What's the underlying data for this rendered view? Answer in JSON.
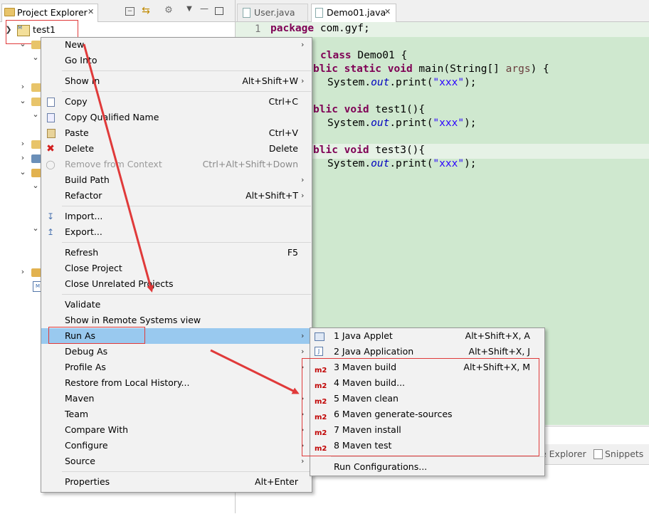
{
  "left_panel": {
    "tab_title": "Project Explorer",
    "tab_close": "✕",
    "tree_root": "test1"
  },
  "editor": {
    "tabs": [
      {
        "label": "User.java",
        "close": ""
      },
      {
        "label": "Demo01.java",
        "close": "✕"
      }
    ],
    "line_number": "1",
    "code": {
      "l1_kw": "package",
      "l1_rest": " com.gyf;",
      "l2_kw": "class",
      "l2_rest": " Demo01 {",
      "l3_kw": "blic static void",
      "l3_rest": " main(String[] ",
      "l3_args": "args",
      "l3_end": ") {",
      "l4_a": "System.",
      "l4_out": "out",
      "l4_b": ".print(",
      "l4_str": "\"xxx\"",
      "l4_c": ");",
      "l5_kw": "blic void",
      "l5_rest": " test1(){",
      "l6_a": "System.",
      "l6_out": "out",
      "l6_b": ".print(",
      "l6_str": "\"xxx\"",
      "l6_c": ");",
      "l7_kw": "blic void",
      "l7_rest": " test3()",
      "l7_end": "{",
      "l8_a": "System.",
      "l8_out": "out",
      "l8_b": ".print(",
      "l8_str": "\"xxx\"",
      "l8_c": ");"
    }
  },
  "bottom_tabs": {
    "explorer": "e Explorer",
    "snippets": "Snippets"
  },
  "context_menu": {
    "items": [
      {
        "label": "New",
        "shortcut": "",
        "submenu": true
      },
      {
        "label": "Go Into",
        "shortcut": ""
      },
      {
        "label": "Show In",
        "shortcut": "Alt+Shift+W",
        "submenu": true
      },
      {
        "label": "Copy",
        "shortcut": "Ctrl+C"
      },
      {
        "label": "Copy Qualified Name",
        "shortcut": ""
      },
      {
        "label": "Paste",
        "shortcut": "Ctrl+V"
      },
      {
        "label": "Delete",
        "shortcut": "Delete"
      },
      {
        "label": "Remove from Context",
        "shortcut": "Ctrl+Alt+Shift+Down",
        "disabled": true
      },
      {
        "label": "Build Path",
        "shortcut": "",
        "submenu": true
      },
      {
        "label": "Refactor",
        "shortcut": "Alt+Shift+T",
        "submenu": true
      },
      {
        "label": "Import...",
        "shortcut": ""
      },
      {
        "label": "Export...",
        "shortcut": ""
      },
      {
        "label": "Refresh",
        "shortcut": "F5"
      },
      {
        "label": "Close Project",
        "shortcut": ""
      },
      {
        "label": "Close Unrelated Projects",
        "shortcut": ""
      },
      {
        "label": "Validate",
        "shortcut": ""
      },
      {
        "label": "Show in Remote Systems view",
        "shortcut": ""
      },
      {
        "label": "Run As",
        "shortcut": "",
        "submenu": true,
        "highlighted": true
      },
      {
        "label": "Debug As",
        "shortcut": "",
        "submenu": true
      },
      {
        "label": "Profile As",
        "shortcut": "",
        "submenu": true
      },
      {
        "label": "Restore from Local History...",
        "shortcut": ""
      },
      {
        "label": "Maven",
        "shortcut": "",
        "submenu": true
      },
      {
        "label": "Team",
        "shortcut": "",
        "submenu": true
      },
      {
        "label": "Compare With",
        "shortcut": "",
        "submenu": true
      },
      {
        "label": "Configure",
        "shortcut": "",
        "submenu": true
      },
      {
        "label": "Source",
        "shortcut": "",
        "submenu": true
      },
      {
        "label": "Properties",
        "shortcut": "Alt+Enter"
      }
    ],
    "arrow": "›"
  },
  "run_as_menu": {
    "items": [
      {
        "label": "1 Java Applet",
        "shortcut": "Alt+Shift+X, A"
      },
      {
        "label": "2 Java Application",
        "shortcut": "Alt+Shift+X, J"
      },
      {
        "label": "3 Maven build",
        "shortcut": "Alt+Shift+X, M"
      },
      {
        "label": "4 Maven build...",
        "shortcut": ""
      },
      {
        "label": "5 Maven clean",
        "shortcut": ""
      },
      {
        "label": "6 Maven generate-sources",
        "shortcut": ""
      },
      {
        "label": "7 Maven install",
        "shortcut": ""
      },
      {
        "label": "8 Maven test",
        "shortcut": ""
      },
      {
        "label": "Run Configurations...",
        "shortcut": ""
      }
    ],
    "maven_badge": "m2"
  },
  "colors": {
    "highlight": "#99c9ef",
    "annotation_red": "#e03a3a",
    "editor_bg": "#cfe8cf"
  }
}
